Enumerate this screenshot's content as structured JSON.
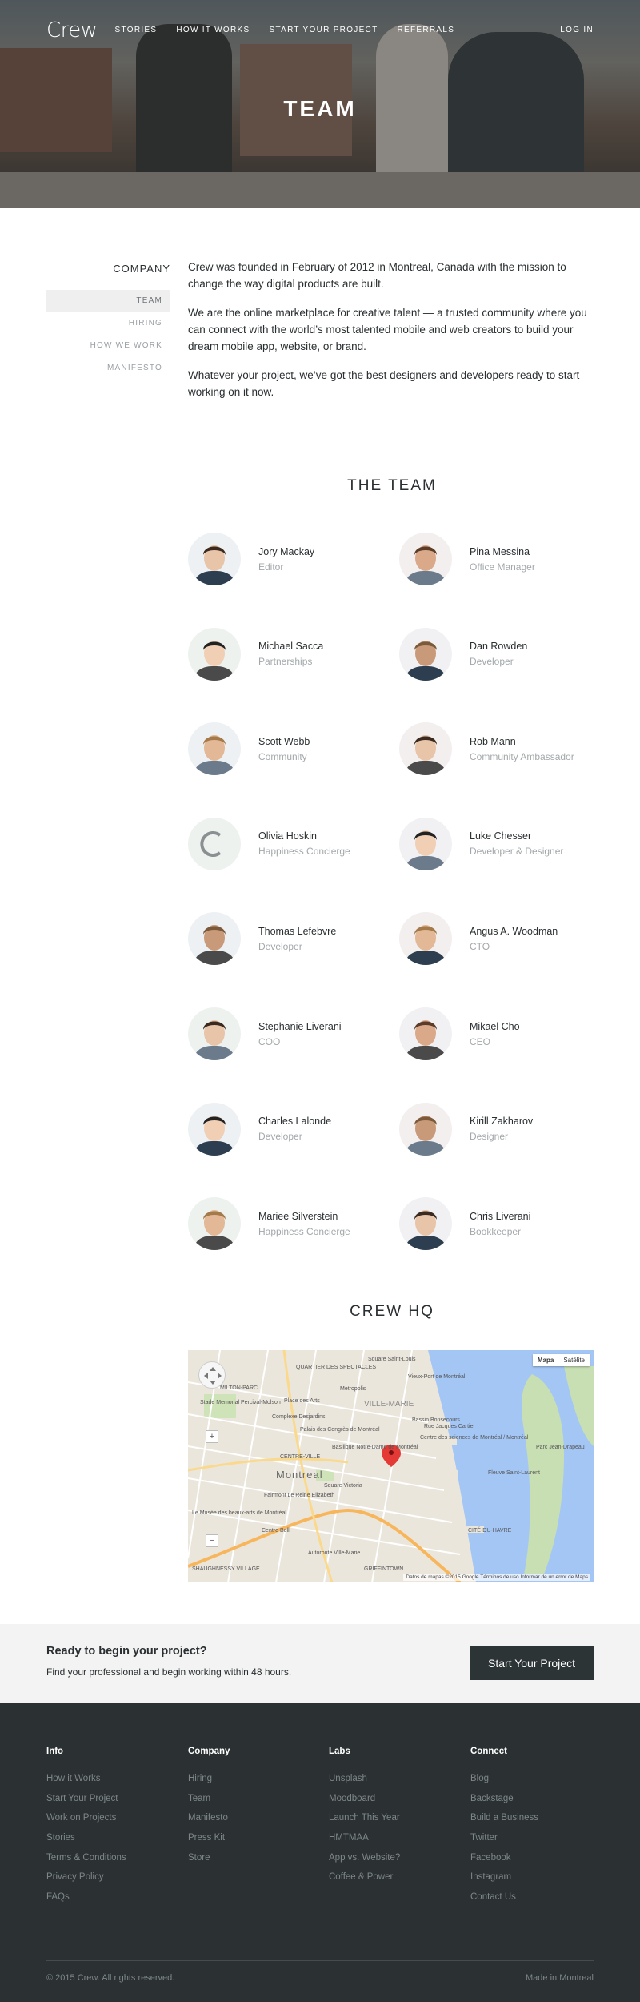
{
  "nav": {
    "logo": "Crew",
    "links": [
      "STORIES",
      "HOW IT WORKS",
      "START YOUR PROJECT",
      "REFERRALS"
    ],
    "login": "LOG IN"
  },
  "hero": {
    "title": "TEAM"
  },
  "sidebar": {
    "title": "COMPANY",
    "items": [
      "TEAM",
      "HIRING",
      "HOW WE WORK",
      "MANIFESTO"
    ]
  },
  "intro": {
    "p1": "Crew was founded in February of 2012 in Montreal, Canada with the mission to change the way digital products are built.",
    "p2": "We are the online marketplace for creative talent — a trusted community where you can connect with the world’s most talented mobile and web creators to build your dream mobile app, website, or brand.",
    "p3": "Whatever your project, we’ve got the best designers and developers ready to start working on it now."
  },
  "team": {
    "title": "THE TEAM",
    "members": [
      {
        "name": "Jory Mackay",
        "role": "Editor"
      },
      {
        "name": "Pina Messina",
        "role": "Office Manager"
      },
      {
        "name": "Michael Sacca",
        "role": "Partnerships"
      },
      {
        "name": "Dan Rowden",
        "role": "Developer"
      },
      {
        "name": "Scott Webb",
        "role": "Community"
      },
      {
        "name": "Rob Mann",
        "role": "Community Ambassador"
      },
      {
        "name": "Olivia Hoskin",
        "role": "Happiness Concierge"
      },
      {
        "name": "Luke Chesser",
        "role": "Developer & Designer"
      },
      {
        "name": "Thomas Lefebvre",
        "role": "Developer"
      },
      {
        "name": "Angus A. Woodman",
        "role": "CTO"
      },
      {
        "name": "Stephanie Liverani",
        "role": "COO"
      },
      {
        "name": "Mikael Cho",
        "role": "CEO"
      },
      {
        "name": "Charles Lalonde",
        "role": "Developer"
      },
      {
        "name": "Kirill Zakharov",
        "role": "Designer"
      },
      {
        "name": "Mariee Silverstein",
        "role": "Happiness Concierge"
      },
      {
        "name": "Chris Liverani",
        "role": "Bookkeeper"
      }
    ]
  },
  "hq": {
    "title": "CREW HQ",
    "map": {
      "btn_map": "Mapa",
      "btn_sat": "Satélite",
      "credit": "Datos de mapas ©2015 Google   Términos de uso   Informar de un error de Maps",
      "city": "Montreal",
      "labels": [
        "Vieux-Port de Montréal",
        "Metropolis",
        "Place des Arts",
        "Complexe Desjardins",
        "VILLE-MARIE",
        "Palais des Congrès de Montréal",
        "Centre des sciences de Montréal / Montréal",
        "Basilique Notre-Dame de Montréal",
        "Square Victoria",
        "Fairmont Le Reine Elizabeth",
        "Centre Bell",
        "CENTRE-VILLE",
        "QUARTIER DES SPECTACLES",
        "GRIFFINTOWN",
        "SHAUGHNESSY VILLAGE",
        "CITÉ-DU-HAVRE",
        "Parc Jean-Drapeau",
        "Stade Memorial Percival-Molson",
        "MILTON-PARC",
        "Bassin Bonsecours",
        "Rue Jacques Cartier",
        "Fleuve Saint-Laurent",
        "Square Saint-Louis",
        "Le Musée des beaux-arts de Montréal",
        "Autoroute Ville-Marie"
      ]
    }
  },
  "cta": {
    "title": "Ready to begin your project?",
    "subtitle": "Find your professional and begin working within 48 hours.",
    "button": "Start Your Project"
  },
  "footer": {
    "columns": [
      {
        "title": "Info",
        "links": [
          "How it Works",
          "Start Your Project",
          "Work on Projects",
          "Stories",
          "Terms & Conditions",
          "Privacy Policy",
          "FAQs"
        ]
      },
      {
        "title": "Company",
        "links": [
          "Hiring",
          "Team",
          "Manifesto",
          "Press Kit",
          "Store"
        ]
      },
      {
        "title": "Labs",
        "links": [
          "Unsplash",
          "Moodboard",
          "Launch This Year",
          "HMTMAA",
          "App vs. Website?",
          "Coffee & Power"
        ]
      },
      {
        "title": "Connect",
        "links": [
          "Blog",
          "Backstage",
          "Build a Business",
          "Twitter",
          "Facebook",
          "Instagram",
          "Contact Us"
        ]
      }
    ],
    "copyright": "© 2015 Crew. All rights reserved.",
    "made_in": "Made in Montreal"
  },
  "colors": {
    "dark": "#2b3133",
    "text": "#2a2f31",
    "muted": "#a3a8ab",
    "cta_bg": "#f3f3f3",
    "button": "#2d3436",
    "map_water": "#a4c6f5",
    "map_pin": "#e53935"
  }
}
